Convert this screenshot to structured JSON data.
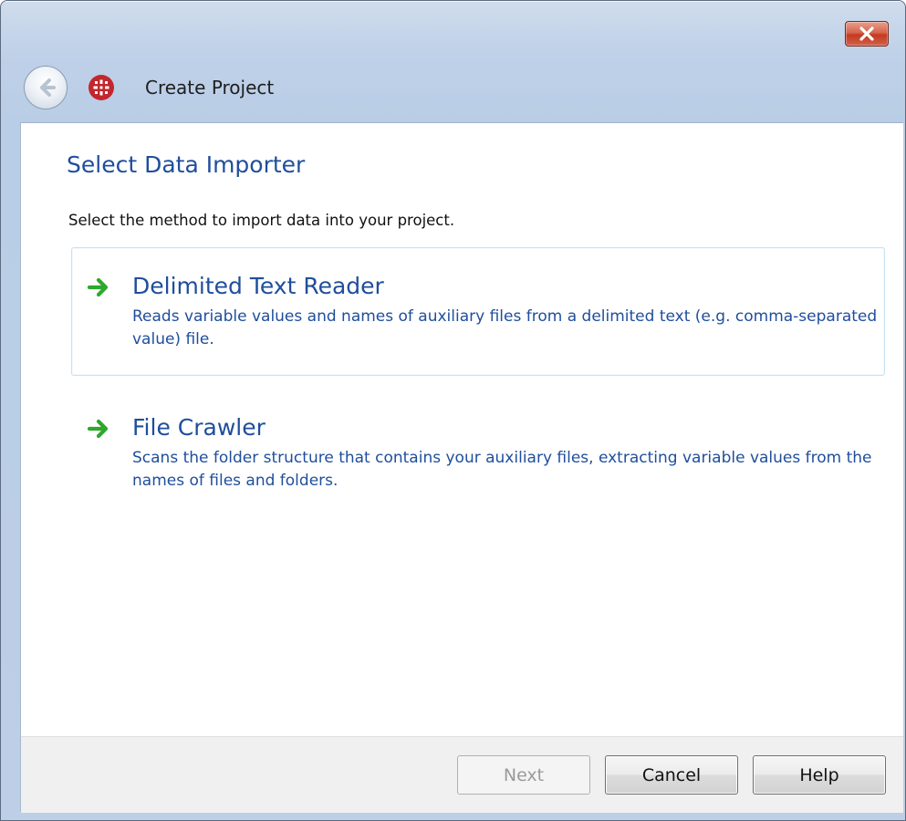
{
  "window": {
    "title": "Create Project",
    "icons": {
      "back": "back-arrow-icon",
      "app": "app-grid-icon",
      "close": "close-icon"
    },
    "colors": {
      "close_button": "#c94129",
      "app_icon": "#c1272d",
      "heading": "#1f4e9c",
      "arrow": "#2ea82e"
    }
  },
  "page": {
    "heading": "Select Data Importer",
    "instruction": "Select the method to import data into your project."
  },
  "options": [
    {
      "title": "Delimited Text Reader",
      "description": "Reads variable values and names of auxiliary files from a delimited text (e.g. comma-separated value) file.",
      "icon": "green-arrow-icon",
      "hovered": true
    },
    {
      "title": "File Crawler",
      "description": "Scans the folder structure that contains your auxiliary files, extracting variable values from the names of files and folders.",
      "icon": "green-arrow-icon",
      "hovered": false
    }
  ],
  "buttons": {
    "next": {
      "label": "Next",
      "enabled": false
    },
    "cancel": {
      "label": "Cancel",
      "enabled": true
    },
    "help": {
      "label": "Help",
      "enabled": true
    }
  }
}
